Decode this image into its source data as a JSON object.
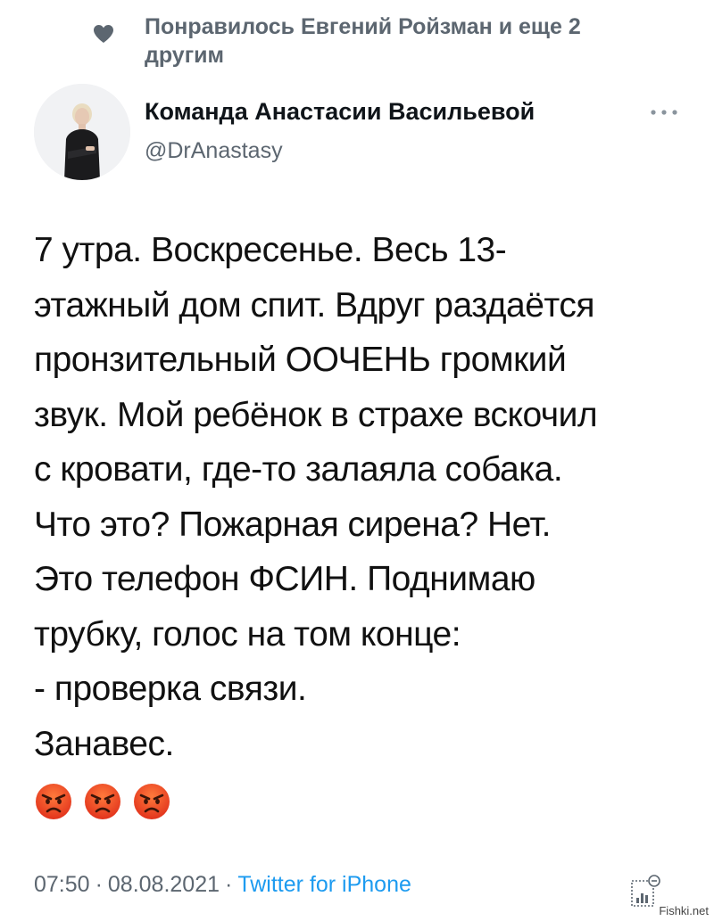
{
  "social_context": {
    "liked_by": "Понравилось Евгений Ройзман и еще 2 другим",
    "icon": "heart-icon"
  },
  "author": {
    "display_name": "Команда Анастасии Васильевой",
    "handle": "@DrAnastasy",
    "avatar_icon": "avatar-photo"
  },
  "tweet": {
    "lines": [
      "7 утра. Воскресенье. Весь 13-",
      "этажный дом спит. Вдруг раздаётся",
      "пронзительный ООЧЕНЬ громкий",
      "звук. Мой ребёнок в страхе вскочил",
      "с кровати, где-то залаяла собака.",
      "Что это? Пожарная сирена? Нет.",
      "Это телефон ФСИН. Поднимаю",
      "трубку, голос на том конце:",
      "- проверка связи.",
      "Занавес."
    ],
    "emoji": [
      "angry-face",
      "angry-face",
      "angry-face"
    ]
  },
  "footer": {
    "time": "07:50",
    "separator": "·",
    "date": "08.08.2021",
    "source": "Twitter for iPhone",
    "analytics_icon": "analytics-icon"
  },
  "colors": {
    "secondary_text": "#5c6670",
    "link": "#1d9bf0",
    "primary_text": "#111111"
  },
  "watermark": "Fishki.net"
}
